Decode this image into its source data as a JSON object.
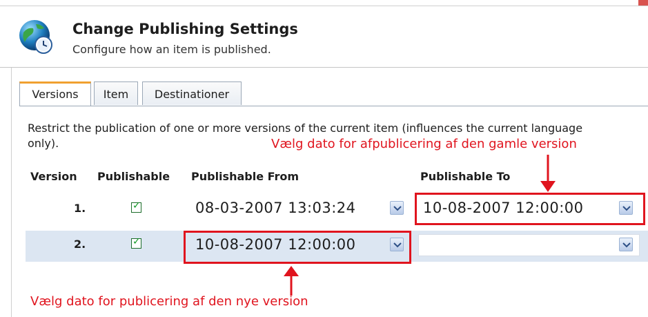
{
  "header": {
    "title": "Change Publishing Settings",
    "subtitle": "Configure how an item is published."
  },
  "tabs": [
    {
      "label": "Versions",
      "active": true
    },
    {
      "label": "Item",
      "active": false
    },
    {
      "label": "Destinationer",
      "active": false
    }
  ],
  "description": "Restrict the publication of one or more versions of the current item (influences the current language only).",
  "table": {
    "headers": [
      "Version",
      "Publishable",
      "Publishable From",
      "Publishable To"
    ],
    "rows": [
      {
        "version": "1.",
        "publishable": true,
        "from": "08-03-2007 13:03:24",
        "to": "10-08-2007 12:00:00"
      },
      {
        "version": "2.",
        "publishable": true,
        "from": "10-08-2007 12:00:00",
        "to": ""
      }
    ]
  },
  "annotations": {
    "top": "Vælg dato for afpublicering af den gamle version",
    "bottom": "Vælg dato for publicering af den nye version"
  },
  "colors": {
    "annotation_red": "#e0141e",
    "active_tab_accent": "#f0a030",
    "selected_row_bg": "#dce6f2",
    "checkbox_check": "#139a28"
  },
  "icons": {
    "header_logo": "globe-clock-icon",
    "dropdown": "chevron-down-icon"
  }
}
